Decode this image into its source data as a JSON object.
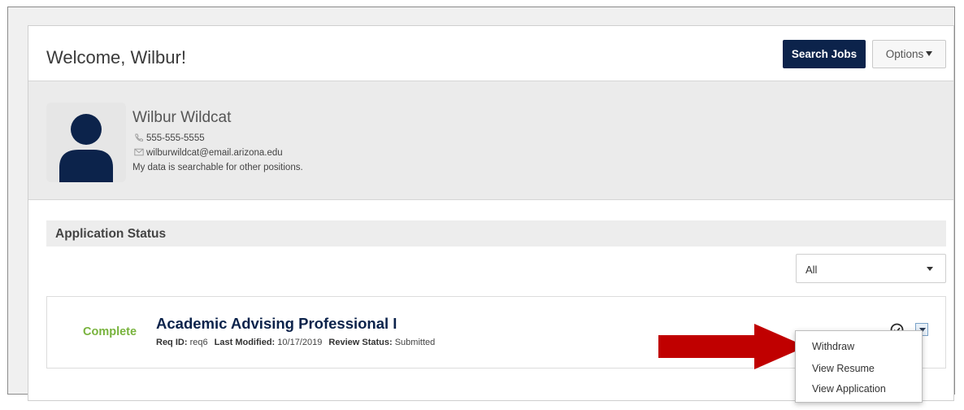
{
  "header": {
    "welcome": "Welcome, Wilbur!",
    "search_jobs": "Search Jobs",
    "options": "Options"
  },
  "profile": {
    "name": "Wilbur Wildcat",
    "phone": "555-555-5555",
    "email": "wilburwildcat@email.arizona.edu",
    "searchable_note": "My data is searchable for other positions."
  },
  "applications": {
    "section_title": "Application Status",
    "filter": {
      "selected": "All"
    },
    "items": [
      {
        "status": "Complete",
        "title": "Academic Advising Professional I",
        "req_id_label": "Req ID:",
        "req_id": "req6",
        "last_modified_label": "Last Modified:",
        "last_modified": "10/17/2019",
        "review_status_label": "Review Status:",
        "review_status": "Submitted"
      }
    ],
    "menu": {
      "items": [
        "Withdraw",
        "View Resume",
        "View Application"
      ]
    }
  },
  "icons": {
    "phone": "phone-icon",
    "email": "envelope-icon",
    "avatar": "user-silhouette-icon",
    "status_check": "circle-check-icon",
    "dropdown": "chevron-down-icon",
    "pointer": "red-arrow"
  },
  "colors": {
    "brand_navy": "#0c234b",
    "complete_green": "#78b33d",
    "pointer_red": "#c00000"
  }
}
